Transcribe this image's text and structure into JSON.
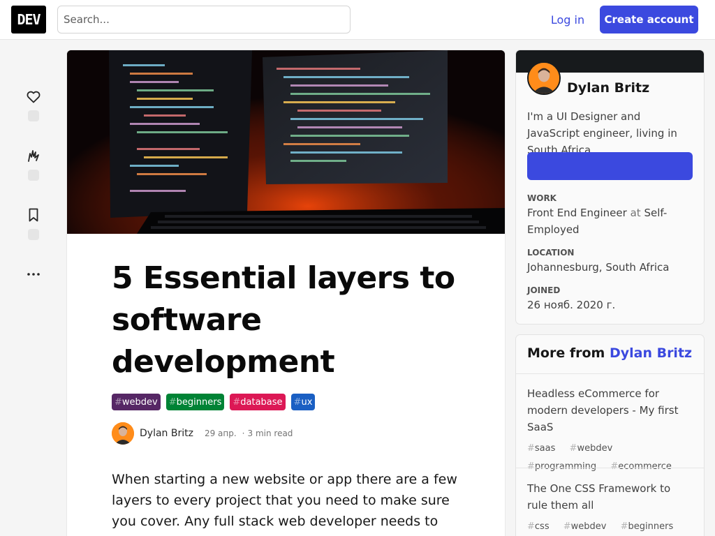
{
  "header": {
    "logo": "DEV",
    "search_placeholder": "Search...",
    "login_label": "Log in",
    "create_label": "Create account"
  },
  "article": {
    "title": "5 Essential layers to software development",
    "tags": [
      {
        "name": "webdev",
        "color": "#562765"
      },
      {
        "name": "beginners",
        "color": "#008335"
      },
      {
        "name": "database",
        "color": "#dc1855"
      },
      {
        "name": "ux",
        "color": "#1a5fc3"
      }
    ],
    "author": "Dylan Britz",
    "date": "29 апр.",
    "read_time": "3 min read",
    "body": "When starting a new website or app there are a few layers to every project that you need to make sure you cover. Any full stack web developer needs to understand"
  },
  "profile": {
    "name": "Dylan Britz",
    "bio": "I'm a UI Designer and JavaScript engineer, living in South Africa",
    "work_label": "WORK",
    "work_role": "Front End Engineer",
    "work_at": "at",
    "work_company": "Self-Employed",
    "location_label": "LOCATION",
    "location": "Johannesburg, South Africa",
    "joined_label": "JOINED",
    "joined": "26 нояб. 2020 г."
  },
  "more_from": {
    "heading": "More from",
    "author": "Dylan Britz",
    "posts": [
      {
        "title": "Headless eCommerce for modern developers - My first SaaS",
        "tags": [
          "saas",
          "webdev",
          "programming",
          "ecommerce"
        ]
      },
      {
        "title": "The One CSS Framework to rule them all",
        "tags": [
          "css",
          "webdev",
          "beginners"
        ]
      }
    ]
  },
  "colors": {
    "accent": "#3b49df",
    "avatar_bg": "#ff8c1a"
  }
}
